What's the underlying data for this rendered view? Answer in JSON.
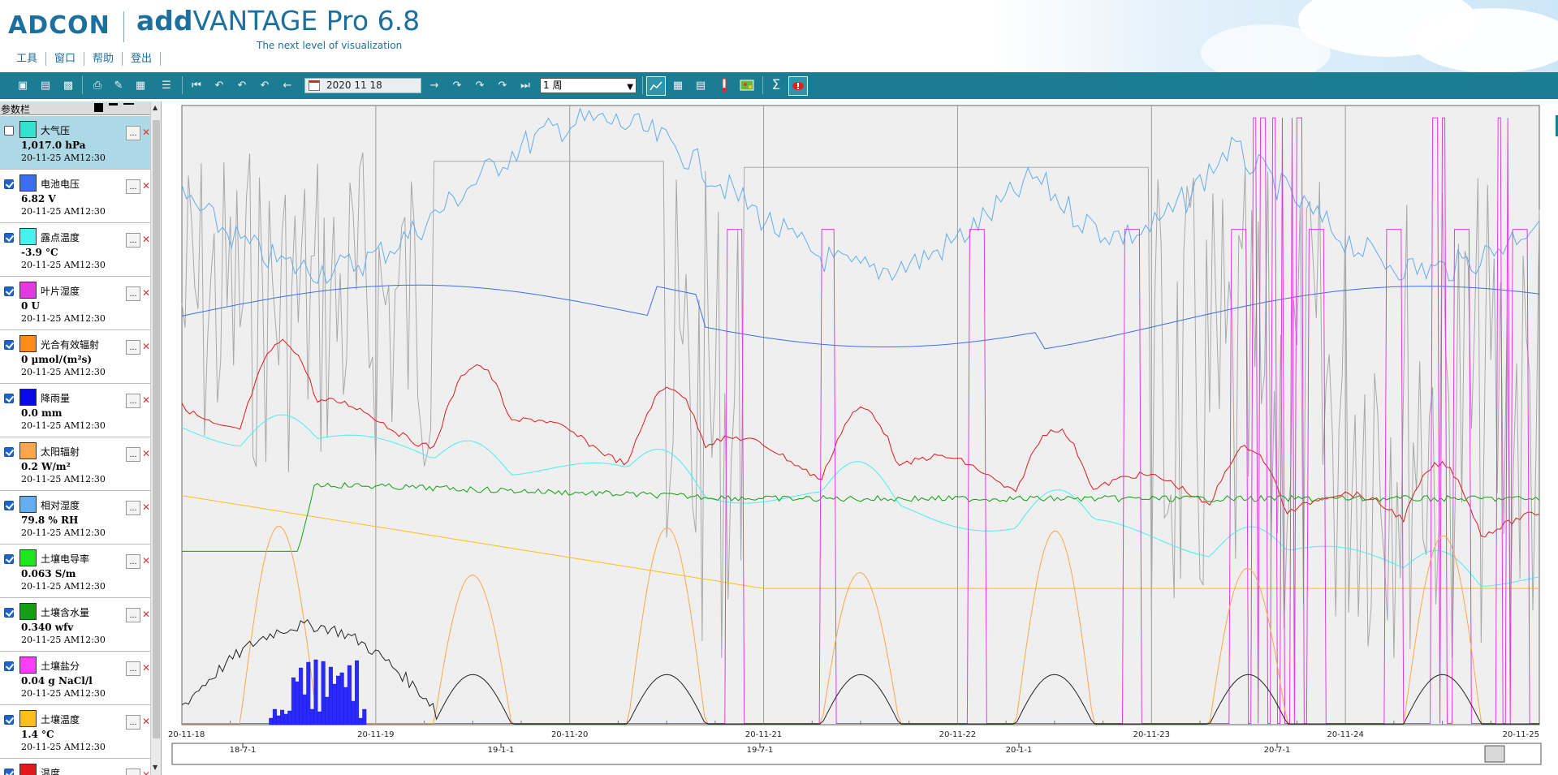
{
  "header": {
    "logo": "ADCON",
    "title_bold": "add",
    "title_rest": "VANTAGE Pro 6.8",
    "subtitle": "The next level of visualization",
    "menu": [
      "工具",
      "窗口",
      "帮助",
      "登出"
    ]
  },
  "toolbar": {
    "date": "2020 11 18",
    "period": "1 周",
    "icons": [
      "save-icon",
      "save-as-icon",
      "export-icon",
      "print-icon",
      "pdf-icon",
      "csv-icon",
      "report-icon",
      "skip-first-icon",
      "back-30-icon",
      "back-7-icon",
      "back-1-icon",
      "back-icon",
      "forward-icon",
      "forward-1-icon",
      "forward-7-icon",
      "forward-30-icon",
      "skip-last-icon",
      "graph-view-icon",
      "table-view-icon",
      "list-view-icon",
      "thermometer-icon",
      "map-icon",
      "sum-icon",
      "alarm-icon"
    ]
  },
  "sidebar": {
    "title": "参数栏",
    "params": [
      {
        "name": "大气压",
        "value": "1,017.0 hPa",
        "time": "20-11-25 AM12:30",
        "color": "#33e3d0",
        "checked": false,
        "selected": true
      },
      {
        "name": "电池电压",
        "value": "6.82 V",
        "time": "20-11-25 AM12:30",
        "color": "#3d6ef0",
        "checked": true
      },
      {
        "name": "露点温度",
        "value": "-3.9 °C",
        "time": "20-11-25 AM12:30",
        "color": "#49f0f0",
        "checked": true
      },
      {
        "name": "叶片湿度",
        "value": "0 U",
        "time": "20-11-25 AM12:30",
        "color": "#e03ae0",
        "checked": true
      },
      {
        "name": "光合有效辐射",
        "value": "0 µmol/(m²s)",
        "time": "20-11-25 AM12:30",
        "color": "#ff8c1a",
        "checked": true
      },
      {
        "name": "降雨量",
        "value": "0.0 mm",
        "time": "20-11-25 AM12:30",
        "color": "#0a0ae6",
        "checked": true
      },
      {
        "name": "太阳辐射",
        "value": "0.2 W/m²",
        "time": "20-11-25 AM12:30",
        "color": "#ffa64d",
        "checked": true
      },
      {
        "name": "相对湿度",
        "value": "79.8 % RH",
        "time": "20-11-25 AM12:30",
        "color": "#62aef0",
        "checked": true
      },
      {
        "name": "土壤电导率",
        "value": "0.063 S/m",
        "time": "20-11-25 AM12:30",
        "color": "#1de61d",
        "checked": true
      },
      {
        "name": "土壤含水量",
        "value": "0.340 wfv",
        "time": "20-11-25 AM12:30",
        "color": "#12a012",
        "checked": true
      },
      {
        "name": "土壤盐分",
        "value": "0.04 g NaCl/l",
        "time": "20-11-25 AM12:30",
        "color": "#ff3cff",
        "checked": true
      },
      {
        "name": "土壤温度",
        "value": "1.4 °C",
        "time": "20-11-25 AM12:30",
        "color": "#ffbf1a",
        "checked": true
      },
      {
        "name": "温度",
        "value": "",
        "time": "",
        "color": "#e01a1a",
        "checked": true
      }
    ]
  },
  "chart": {
    "x_labels": [
      "20-11-18",
      "20-11-19",
      "20-11-20",
      "20-11-21",
      "20-11-22",
      "20-11-23",
      "20-11-24",
      "20-11-25"
    ],
    "overview_labels": [
      "18-7-1",
      "19-1-1",
      "19-7-1",
      "20-1-1",
      "20-7-1"
    ]
  }
}
